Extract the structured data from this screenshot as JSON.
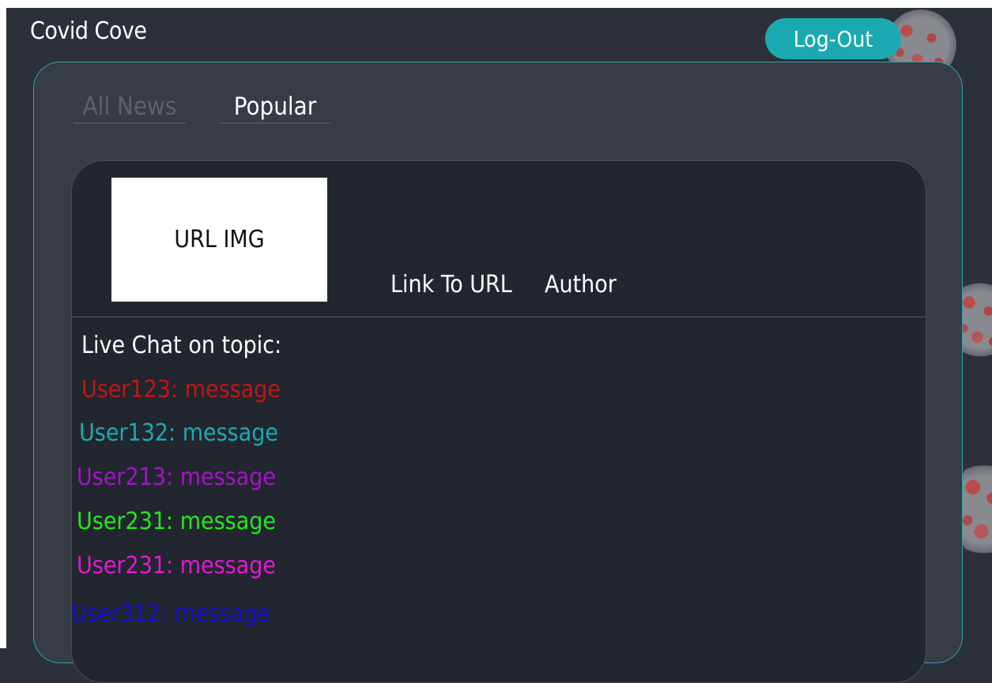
{
  "app": {
    "title": "Covid Cove"
  },
  "header": {
    "logout_label": "Log-Out"
  },
  "tabs": [
    {
      "label": "All News"
    },
    {
      "label": "Popular"
    }
  ],
  "article": {
    "image_placeholder": "URL IMG",
    "link_label": "Link To URL",
    "author_label": "Author"
  },
  "chat": {
    "title": "Live Chat on topic:",
    "messages": [
      {
        "text": "User123: message",
        "color": "#c01616"
      },
      {
        "text": "User132: message",
        "color": "#1ba9b1"
      },
      {
        "text": "User213: message",
        "color": "#a313c9"
      },
      {
        "text": "User231: message",
        "color": "#22e81f"
      },
      {
        "text": "User231: message",
        "color": "#e318d2"
      },
      {
        "text": "User312: message",
        "color": "#1a0fd1"
      }
    ]
  },
  "colors": {
    "background": "#2b3039",
    "panel": "#373c45",
    "card": "#22262e",
    "accent": "#1ba9b1"
  }
}
